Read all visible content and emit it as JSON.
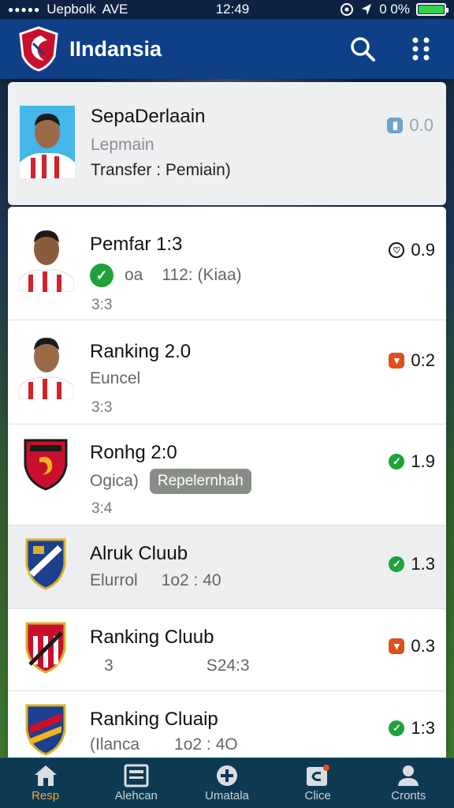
{
  "status_bar": {
    "carrier": "Uepbolk",
    "network": "AVE",
    "time": "12:49",
    "battery": "0 0%"
  },
  "app": {
    "title": "IIndansia",
    "brand_color": "#0f3f86"
  },
  "featured": {
    "title": "SepaDerlaain",
    "subtitle": "Lepmain",
    "detail": "Transfer : Pemiain)",
    "score": "0.0"
  },
  "items": [
    {
      "name": "Pemfar 1:3",
      "sub_a": "oa",
      "sub_b": "112: (Kiaa)",
      "line3": "3:3",
      "score": "0.9",
      "badge": "outline",
      "icon": "player-photo"
    },
    {
      "name": "Ranking 2.0",
      "sub_a": "Euncel",
      "sub_b": "",
      "line3": "3:3",
      "score": "0:2",
      "badge": "orange",
      "icon": "player-photo"
    },
    {
      "name": "Ronhg 2:0",
      "sub_a": "Ogica)",
      "sub_b": "Repelernhah",
      "line3": "3:4",
      "score": "1.9",
      "badge": "green",
      "icon": "club-crest"
    },
    {
      "name": "Alruk Cluub",
      "sub_a": "Elurrol",
      "sub_b": "1o2 : 40",
      "line3": "",
      "score": "1.3",
      "badge": "green",
      "icon": "club-crest"
    },
    {
      "name": "Ranking Cluub",
      "sub_a": "3",
      "sub_b": "S24:3",
      "line3": "",
      "score": "0.3",
      "badge": "orange",
      "icon": "club-crest"
    },
    {
      "name": "Ranking Cluaip",
      "sub_a": "(Ilanca",
      "sub_b": "1o2 : 4O",
      "line3": "",
      "score": "1:3",
      "badge": "green",
      "icon": "club-crest"
    }
  ],
  "nav": [
    {
      "label": "Resp",
      "icon": "home-icon",
      "active": true
    },
    {
      "label": "Alehcan",
      "icon": "news-icon",
      "active": false
    },
    {
      "label": "Umatala",
      "icon": "plus-circle-icon",
      "active": false
    },
    {
      "label": "Clice",
      "icon": "chat-icon",
      "active": false
    },
    {
      "label": "Cronts",
      "icon": "profile-icon",
      "active": false
    }
  ],
  "colors": {
    "accent": "#f2a54a",
    "positive": "#1fa23a",
    "negative": "#e0501c"
  }
}
